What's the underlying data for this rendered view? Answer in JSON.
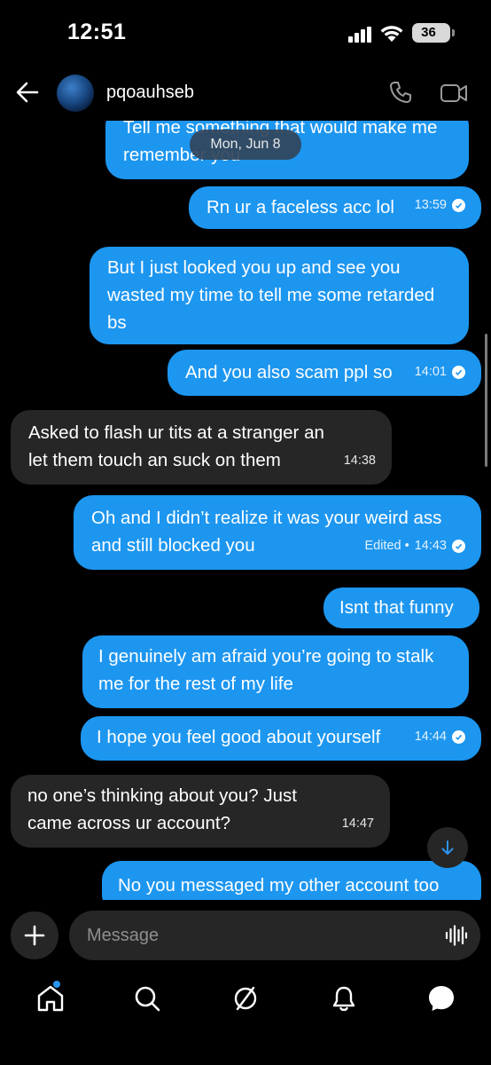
{
  "status_bar": {
    "time": "12:51",
    "battery": "36"
  },
  "header": {
    "username": "pqoauhseb"
  },
  "date_divider": "Mon, Jun 8",
  "messages": [
    {
      "direction": "outgoing",
      "text": "Tell me something that would make me remember you",
      "time": "",
      "edited": ""
    },
    {
      "direction": "outgoing",
      "text": "Rn ur a faceless acc lol",
      "time": "13:59",
      "edited": ""
    },
    {
      "direction": "outgoing",
      "text": "But I just looked you up and see you wasted my time to tell me some retarded bs",
      "time": "",
      "edited": ""
    },
    {
      "direction": "outgoing",
      "text": "And you also scam ppl so",
      "time": "14:01",
      "edited": ""
    },
    {
      "direction": "incoming",
      "text": "Asked to flash ur tits at a stranger an let them touch an suck on them",
      "time": "14:38",
      "edited": ""
    },
    {
      "direction": "outgoing",
      "text": "Oh and I didn’t realize it was your weird ass and still blocked you",
      "time": "14:43",
      "edited": "Edited •"
    },
    {
      "direction": "outgoing",
      "text": "Isnt that funny",
      "time": "",
      "edited": ""
    },
    {
      "direction": "outgoing",
      "text": "I genuinely am afraid you’re going to stalk me for the rest of my life",
      "time": "",
      "edited": ""
    },
    {
      "direction": "outgoing",
      "text": "I hope you feel good about yourself",
      "time": "14:44",
      "edited": ""
    },
    {
      "direction": "incoming",
      "text": "no one’s thinking about you? Just came across ur account?",
      "time": "14:47",
      "edited": ""
    },
    {
      "direction": "outgoing",
      "text": "No you messaged my other account too",
      "time": "",
      "edited": ""
    }
  ],
  "composer": {
    "placeholder": "Message"
  },
  "icons": {
    "back": "arrow-left-icon",
    "call": "phone-icon",
    "video": "video-camera-icon",
    "plus": "plus-icon",
    "mic": "voice-waveform-icon",
    "jump": "arrow-down-icon",
    "nav": [
      "home-icon",
      "search-icon",
      "explore-icon",
      "bell-icon",
      "messages-icon"
    ]
  },
  "colors": {
    "outgoing_bubble": "#1d96f0",
    "incoming_bubble": "#262626",
    "background": "#000000",
    "notification_dot": "#2b95f2"
  }
}
